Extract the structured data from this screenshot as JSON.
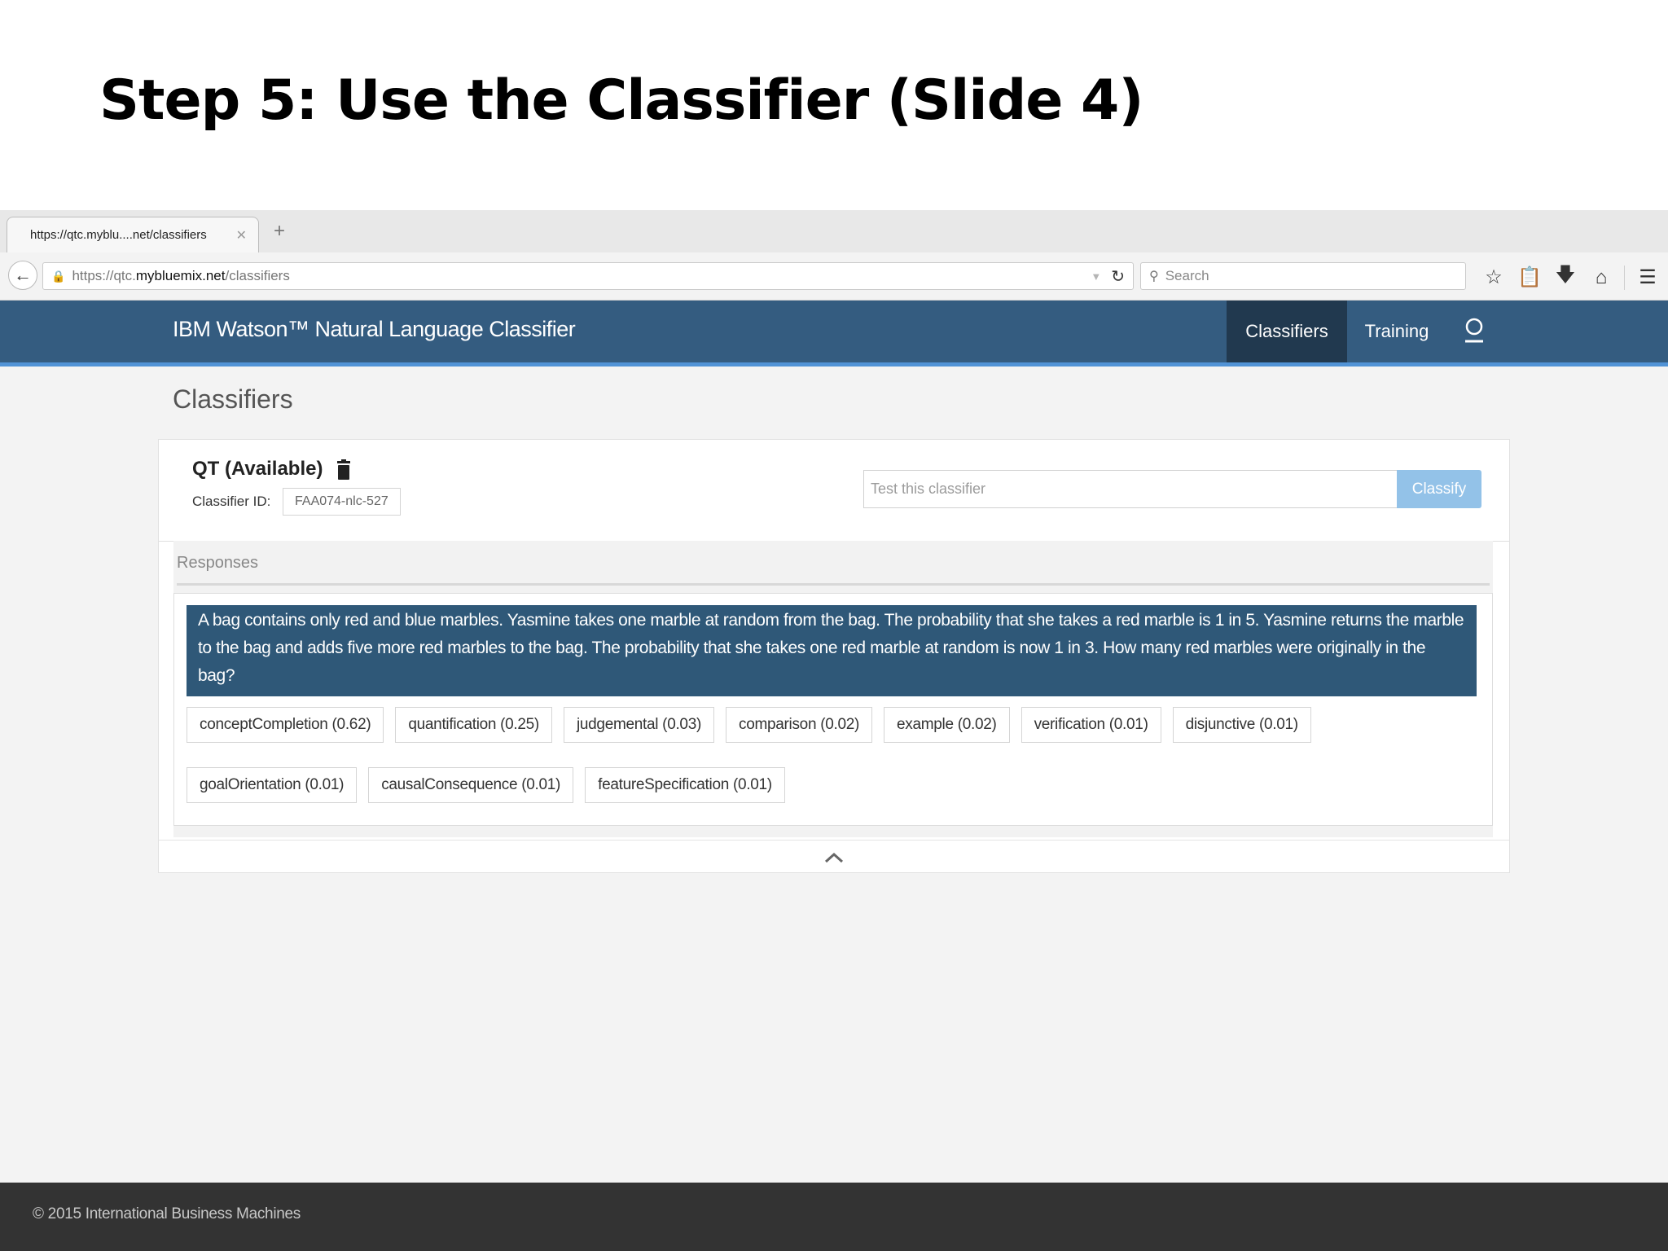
{
  "slide": {
    "title": "Step 5: Use the Classifier (Slide 4)"
  },
  "browser": {
    "tab_title": "https://qtc.myblu....net/classifiers",
    "url_prefix": "https://qtc.",
    "url_domain": "mybluemix.net",
    "url_path": "/classifiers",
    "search_placeholder": "Search",
    "toolbar_icons": [
      "star-icon",
      "clipboard-icon",
      "download-icon",
      "home-icon",
      "menu-icon"
    ]
  },
  "app": {
    "title": "IBM Watson™ Natural Language Classifier",
    "nav": {
      "classifiers": "Classifiers",
      "training": "Training"
    },
    "header_color": "#345c80",
    "accent_color": "#5193d6"
  },
  "page": {
    "heading": "Classifiers",
    "classifier": {
      "name": "QT (Available)",
      "id_label": "Classifier ID:",
      "id_value": "FAA074-nlc-527",
      "test_placeholder": "Test this classifier",
      "classify_label": "Classify"
    },
    "responses": {
      "label": "Responses",
      "question": "A bag contains only red and blue marbles. Yasmine takes one marble at random from the bag. The probability that she takes a red marble is 1 in 5. Yasmine returns the marble to the bag and adds five more red marbles to the bag. The probability that she takes one red marble at random is now 1 in 3. How many red marbles were originally in the bag?",
      "classes": [
        "conceptCompletion (0.62)",
        "quantification (0.25)",
        "judgemental (0.03)",
        "comparison (0.02)",
        "example (0.02)",
        "verification (0.01)",
        "disjunctive (0.01)",
        "goalOrientation (0.01)",
        "causalConsequence (0.01)",
        "featureSpecification (0.01)"
      ]
    }
  },
  "footer": {
    "copyright": "© 2015 International Business Machines"
  }
}
